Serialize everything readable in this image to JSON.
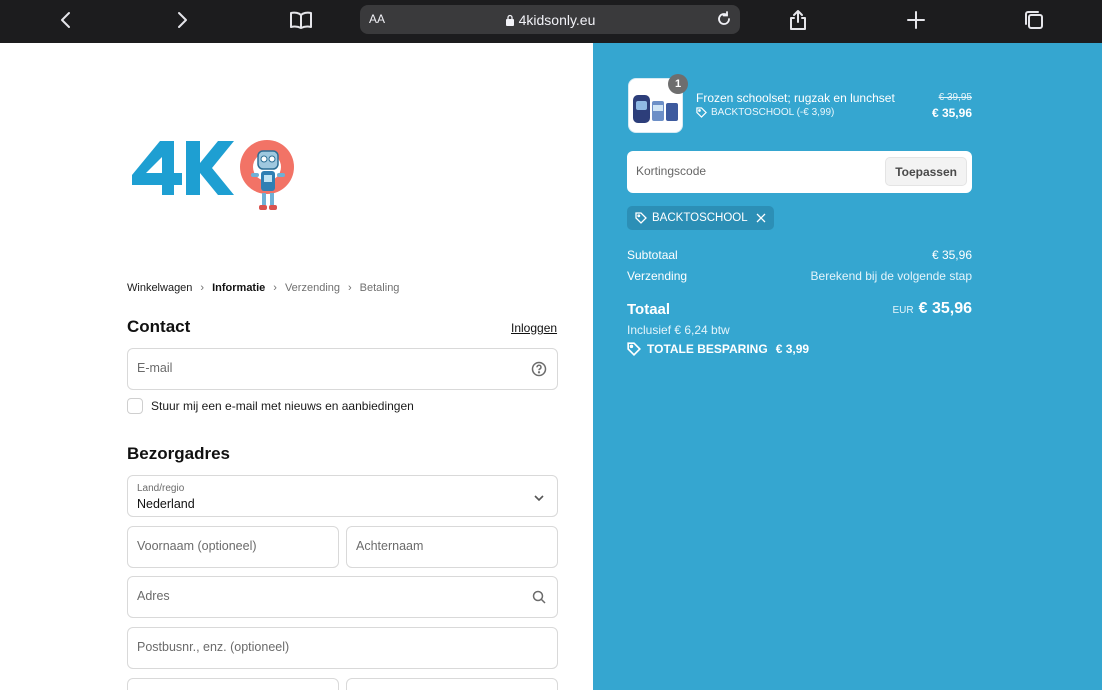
{
  "browser": {
    "text_size_label": "AA",
    "url": "4kidsonly.eu"
  },
  "colors": {
    "summary_bg": "#35a6d0",
    "browser_chrome": "#1c1c1e",
    "logo_blue": "#1e9fd2",
    "logo_red": "#f27366"
  },
  "breadcrumb": {
    "items": [
      "Winkelwagen",
      "Informatie",
      "Verzending",
      "Betaling"
    ],
    "current": "Informatie"
  },
  "contact": {
    "title": "Contact",
    "login_link": "Inloggen",
    "email_placeholder": "E-mail",
    "newsletter_label": "Stuur mij een e-mail met nieuws en aanbiedingen"
  },
  "address": {
    "title": "Bezorgadres",
    "country_label": "Land/regio",
    "country_value": "Nederland",
    "first_name_placeholder": "Voornaam (optioneel)",
    "last_name_placeholder": "Achternaam",
    "address_placeholder": "Adres",
    "address2_placeholder": "Postbusnr., enz. (optioneel)"
  },
  "order": {
    "product": {
      "quantity": "1",
      "name": "Frozen schoolset; rugzak en lunchset",
      "discount_line": "BACKTOSCHOOL (-€ 3,99)",
      "old_price": "€ 39,95",
      "new_price": "€ 35,96"
    },
    "discount_placeholder": "Kortingscode",
    "apply_button": "Toepassen",
    "applied_code": "BACKTOSCHOOL",
    "subtotal_label": "Subtotaal",
    "subtotal_value": "€ 35,96",
    "shipping_label": "Verzending",
    "shipping_value": "Berekend bij de volgende stap",
    "total_label": "Totaal",
    "total_currency": "EUR",
    "total_value": "€ 35,96",
    "vat_line": "Inclusief € 6,24 btw",
    "savings_label": "TOTALE BESPARING",
    "savings_value": "€ 3,99"
  }
}
